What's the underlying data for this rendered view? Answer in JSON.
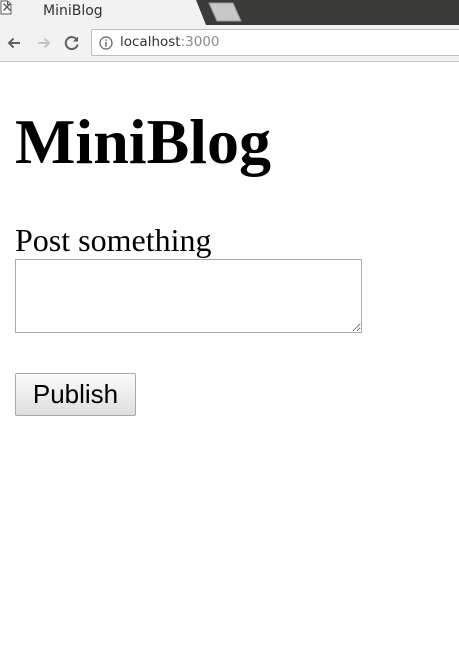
{
  "browser": {
    "tab": {
      "title": "MiniBlog",
      "page_icon": "page-icon",
      "close_icon": "close-icon"
    },
    "new_tab_icon": "new-tab-icon",
    "toolbar": {
      "back_icon": "arrow-left-icon",
      "forward_icon": "arrow-right-icon",
      "reload_icon": "reload-icon",
      "info_icon": "info-icon"
    },
    "url": {
      "host": "localhost",
      "port": ":3000"
    },
    "colors": {
      "tabstrip": "#3a3a38",
      "active_tab": "#f2f2f2",
      "toolbar": "#f2f2f2"
    }
  },
  "page": {
    "title": "MiniBlog",
    "form": {
      "label": "Post something",
      "textarea_value": "",
      "publish_label": "Publish"
    }
  }
}
